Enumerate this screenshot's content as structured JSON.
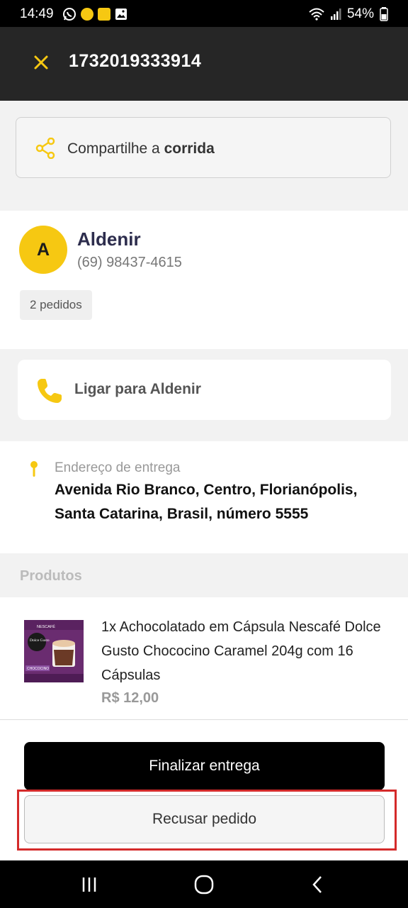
{
  "status_bar": {
    "time": "14:49",
    "battery": "54%",
    "icons": [
      "whatsapp-icon",
      "notification-icon",
      "app-icon",
      "gallery-icon",
      "wifi-icon",
      "signal-icon",
      "battery-icon"
    ]
  },
  "header": {
    "order_id": "1732019333914",
    "close_icon": "close-icon"
  },
  "share": {
    "label_prefix": "Compartilhe a ",
    "label_bold": "corrida",
    "icon": "share-icon"
  },
  "customer": {
    "initial": "A",
    "name": "Aldenir",
    "phone": "(69) 98437-4615",
    "orders_badge": "2 pedidos"
  },
  "call": {
    "label": "Ligar para Aldenir",
    "icon": "phone-icon"
  },
  "address": {
    "label": "Endereço de entrega",
    "value": "Avenida Rio Branco, Centro, Florianópolis, Santa Catarina, Brasil, número 5555",
    "icon": "location-pin-icon"
  },
  "products": {
    "header": "Produtos",
    "items": [
      {
        "name": "1x Achocolatado em Cápsula Nescafé Dolce Gusto Chococino Caramel 204g com 16 Cápsulas",
        "price": "R$ 12,00",
        "thumb_brand": "NESCAFÉ",
        "thumb_line": "Dolce Gusto",
        "thumb_product": "CHOCOCINO"
      }
    ]
  },
  "actions": {
    "finalize": "Finalizar entrega",
    "refuse": "Recusar pedido"
  },
  "colors": {
    "accent": "#f6c812",
    "appbar": "#262626",
    "highlight": "#d42a2a"
  }
}
